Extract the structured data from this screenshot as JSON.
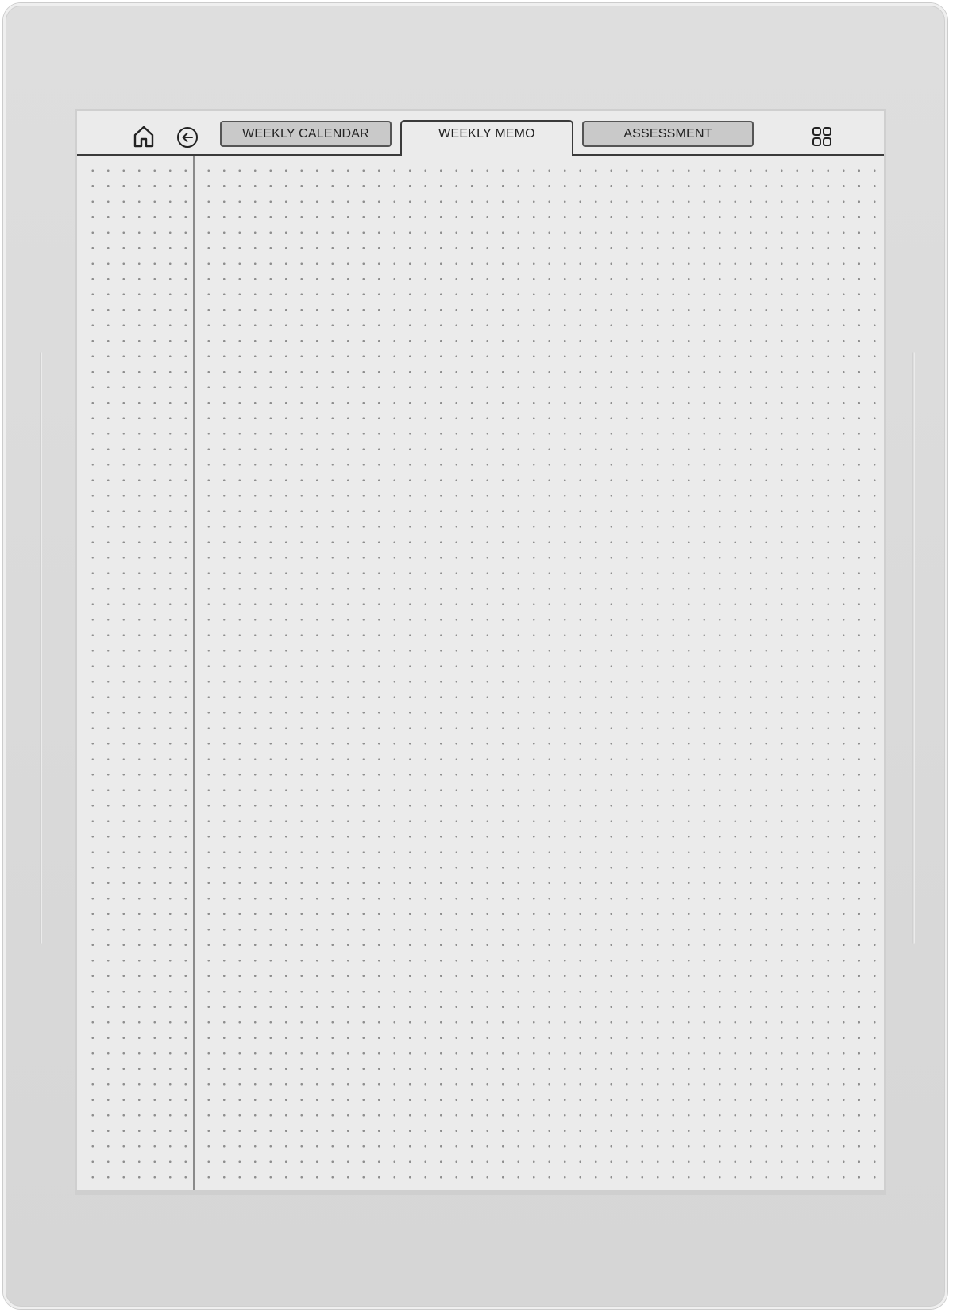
{
  "nav": {
    "home_icon": "home-icon",
    "back_icon": "arrow-left-circle-icon",
    "grid_icon": "grid-icon",
    "tabs": [
      {
        "label": "WEEKLY CALENDAR",
        "active": false
      },
      {
        "label": "WEEKLY MEMO",
        "active": true
      },
      {
        "label": "ASSESSMENT",
        "active": false
      }
    ]
  },
  "page": {
    "style": "dot-grid",
    "colors": {
      "device_frame": "#dadada",
      "screen_bg": "#ebebeb",
      "dot": "#8e8e8e",
      "tab_inactive_bg": "#c9c9c9",
      "ink": "#222222"
    }
  }
}
